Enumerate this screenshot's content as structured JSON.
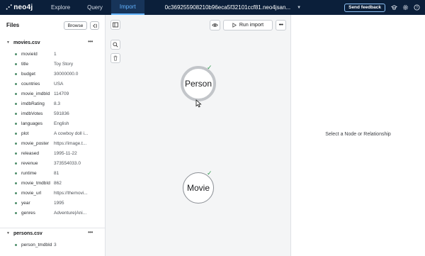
{
  "nav": {
    "logo": "neo4j",
    "tabs": [
      {
        "label": "Explore",
        "active": false
      },
      {
        "label": "Query",
        "active": false
      },
      {
        "label": "Import",
        "active": true
      }
    ],
    "instance": "0c369255908210b96eca5f32101ccf81.neo4jsan...",
    "feedback_label": "Send feedback",
    "icons": [
      "graduation-cap-icon",
      "gear-icon",
      "help-icon"
    ]
  },
  "files_panel": {
    "title": "Files",
    "browse_label": "Browse",
    "files": [
      {
        "name": "movies.csv",
        "fields": [
          {
            "name": "movieId",
            "value": "1"
          },
          {
            "name": "title",
            "value": "Toy Story"
          },
          {
            "name": "budget",
            "value": "30000000.0"
          },
          {
            "name": "countries",
            "value": "USA"
          },
          {
            "name": "movie_imdbId",
            "value": "114709"
          },
          {
            "name": "imdbRating",
            "value": "8.3"
          },
          {
            "name": "imdbVotes",
            "value": "591836"
          },
          {
            "name": "languages",
            "value": "English"
          },
          {
            "name": "plot",
            "value": "A cowboy doll i..."
          },
          {
            "name": "movie_poster",
            "value": "https://image.t..."
          },
          {
            "name": "released",
            "value": "1995-11-22"
          },
          {
            "name": "revenue",
            "value": "373554033.0"
          },
          {
            "name": "runtime",
            "value": "81"
          },
          {
            "name": "movie_tmdbId",
            "value": "862"
          },
          {
            "name": "movie_url",
            "value": "https://themovi..."
          },
          {
            "name": "year",
            "value": "1995"
          },
          {
            "name": "genres",
            "value": "Adventure|Ani..."
          }
        ]
      },
      {
        "name": "persons.csv",
        "fields": [
          {
            "name": "person_tmdbId",
            "value": "3"
          }
        ]
      }
    ]
  },
  "canvas": {
    "run_import_label": "Run import",
    "nodes": [
      {
        "label": "Person",
        "mapped": true
      },
      {
        "label": "Movie",
        "mapped": true
      }
    ]
  },
  "details_panel": {
    "message": "Select a Node or Relationship"
  },
  "colors": {
    "nav_bg": "#0b1f3a",
    "accent": "#63b3ff",
    "status_ok": "#3ecf8e",
    "check": "#2f9b4e"
  }
}
